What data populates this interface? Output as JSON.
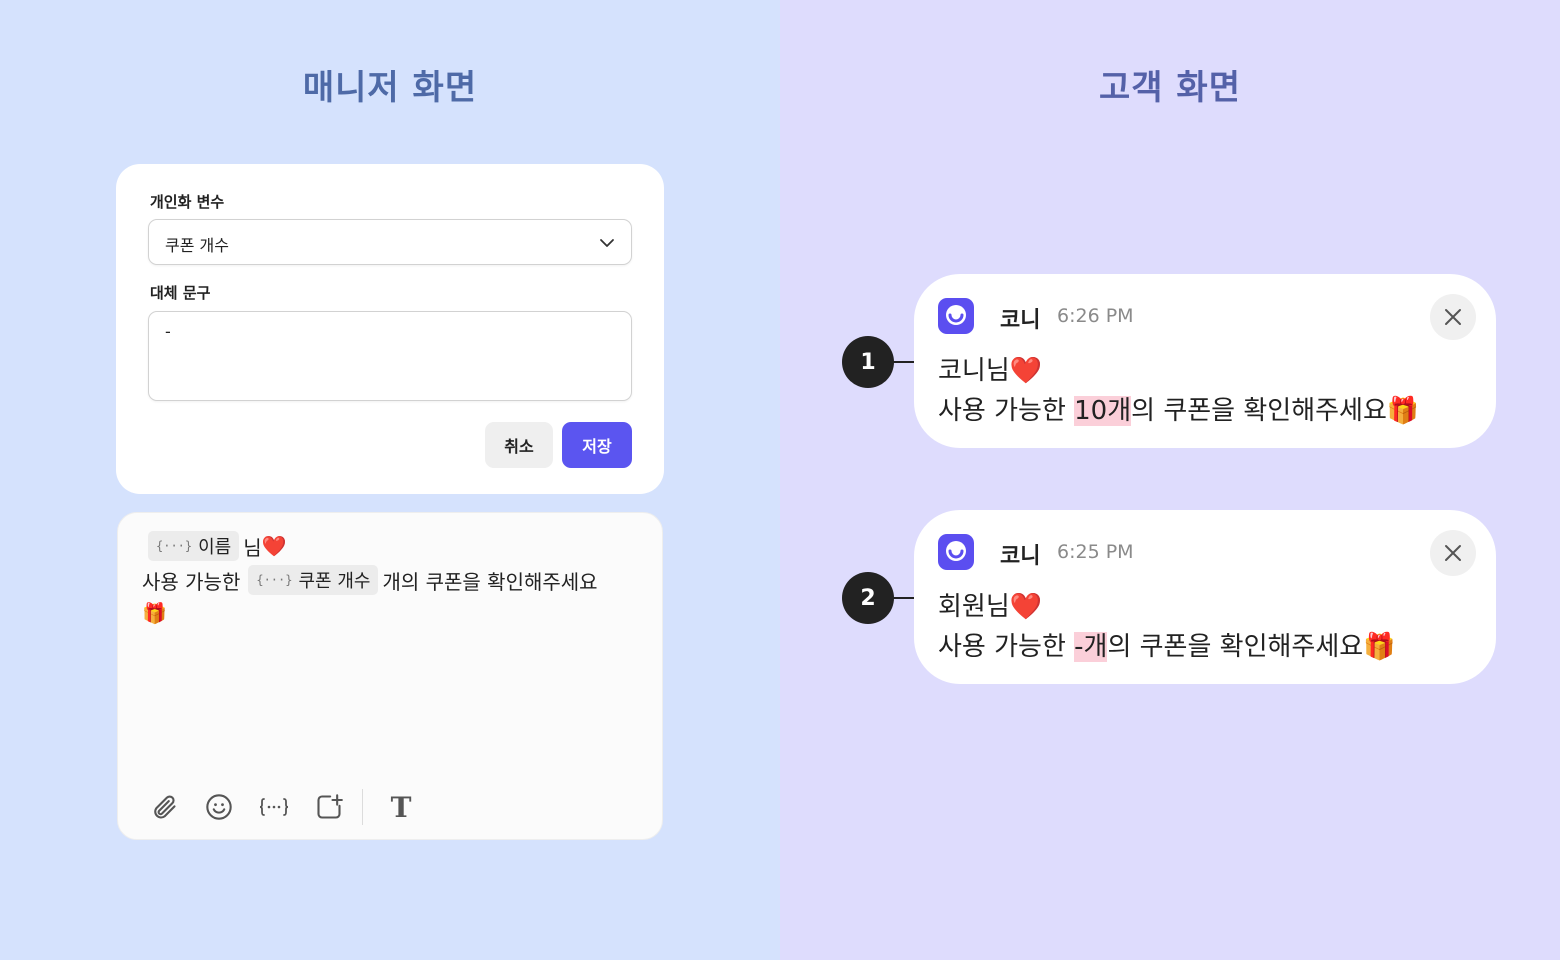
{
  "manager": {
    "title": "매니저 화면",
    "variable_label": "개인화 변수",
    "variable_value": "쿠폰 개수",
    "fallback_label": "대체 문구",
    "fallback_value": "-",
    "cancel_label": "취소",
    "save_label": "저장",
    "save_color": "#5b55f0"
  },
  "editor": {
    "chip_brace": "{···}",
    "chip_name": "이름",
    "line1_suffix": "님",
    "line1_emoji": "❤️",
    "line2_prefix": "사용 가능한",
    "chip_coupon": "쿠폰 개수",
    "line2_suffix": "개의 쿠폰을 확인해주세요",
    "line3_emoji": "🎁",
    "toolbar_icons": [
      "paperclip-icon",
      "emoji-icon",
      "variable-icon",
      "add-image-icon",
      "text-format-icon"
    ],
    "text_icon_glyph": "T"
  },
  "customer": {
    "title": "고객 화면",
    "notifications": [
      {
        "marker": "1",
        "sender": "코니",
        "time": "6:26 PM",
        "line1_name": "코니님",
        "line1_emoji": "❤️",
        "line2_prefix": "사용 가능한 ",
        "highlight": "10개",
        "line2_suffix": "의 쿠폰을 확인해주세요",
        "line2_emoji": "🎁"
      },
      {
        "marker": "2",
        "sender": "코니",
        "time": "6:25 PM",
        "line1_name": "회원님",
        "line1_emoji": "❤️",
        "line2_prefix": "사용 가능한 ",
        "highlight": "-개",
        "line2_suffix": "의 쿠폰을 확인해주세요",
        "line2_emoji": "🎁"
      }
    ],
    "app_icon_color": "#5b4ef0",
    "highlight_color": "#fbcfd9"
  }
}
